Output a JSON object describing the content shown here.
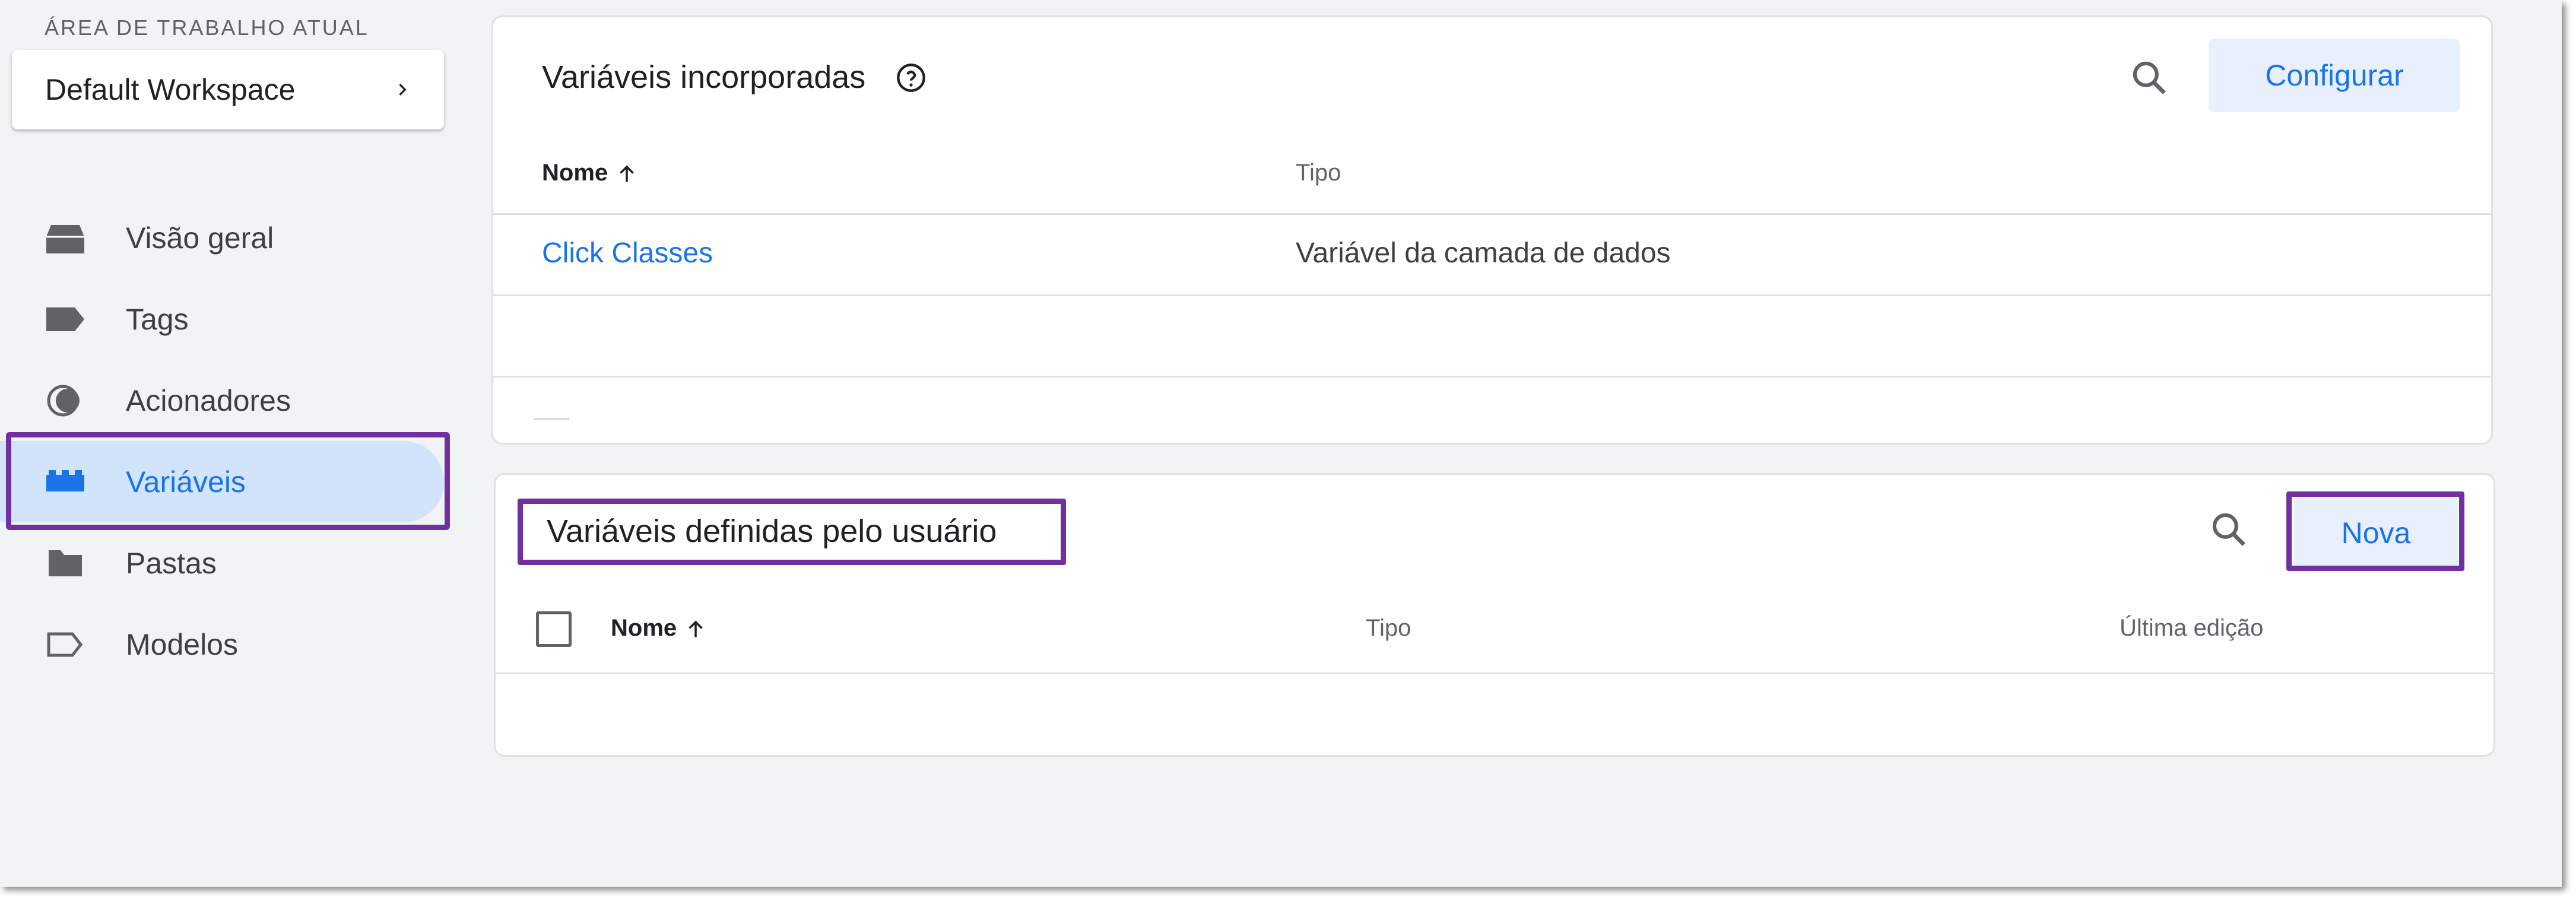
{
  "sidebar": {
    "workspace_label": "ÁREA DE TRABALHO ATUAL",
    "workspace_name": "Default Workspace",
    "items": [
      {
        "label": "Visão geral",
        "icon": "overview-icon"
      },
      {
        "label": "Tags",
        "icon": "tag-icon"
      },
      {
        "label": "Acionadores",
        "icon": "trigger-icon"
      },
      {
        "label": "Variáveis",
        "icon": "variables-icon",
        "active": true
      },
      {
        "label": "Pastas",
        "icon": "folder-icon"
      },
      {
        "label": "Modelos",
        "icon": "template-icon"
      }
    ]
  },
  "builtin": {
    "title": "Variáveis incorporadas",
    "configure_label": "Configurar",
    "col_name": "Nome",
    "col_type": "Tipo",
    "rows": [
      {
        "name": "Click Classes",
        "type": "Variável da camada de dados"
      }
    ]
  },
  "user_defined": {
    "title": "Variáveis definidas pelo usuário",
    "new_label": "Nova",
    "col_name": "Nome",
    "col_type": "Tipo",
    "col_edited": "Última edição"
  },
  "colors": {
    "accent": "#1a73e8",
    "active_bg": "#d2e3fc",
    "highlight": "#7030a0"
  }
}
